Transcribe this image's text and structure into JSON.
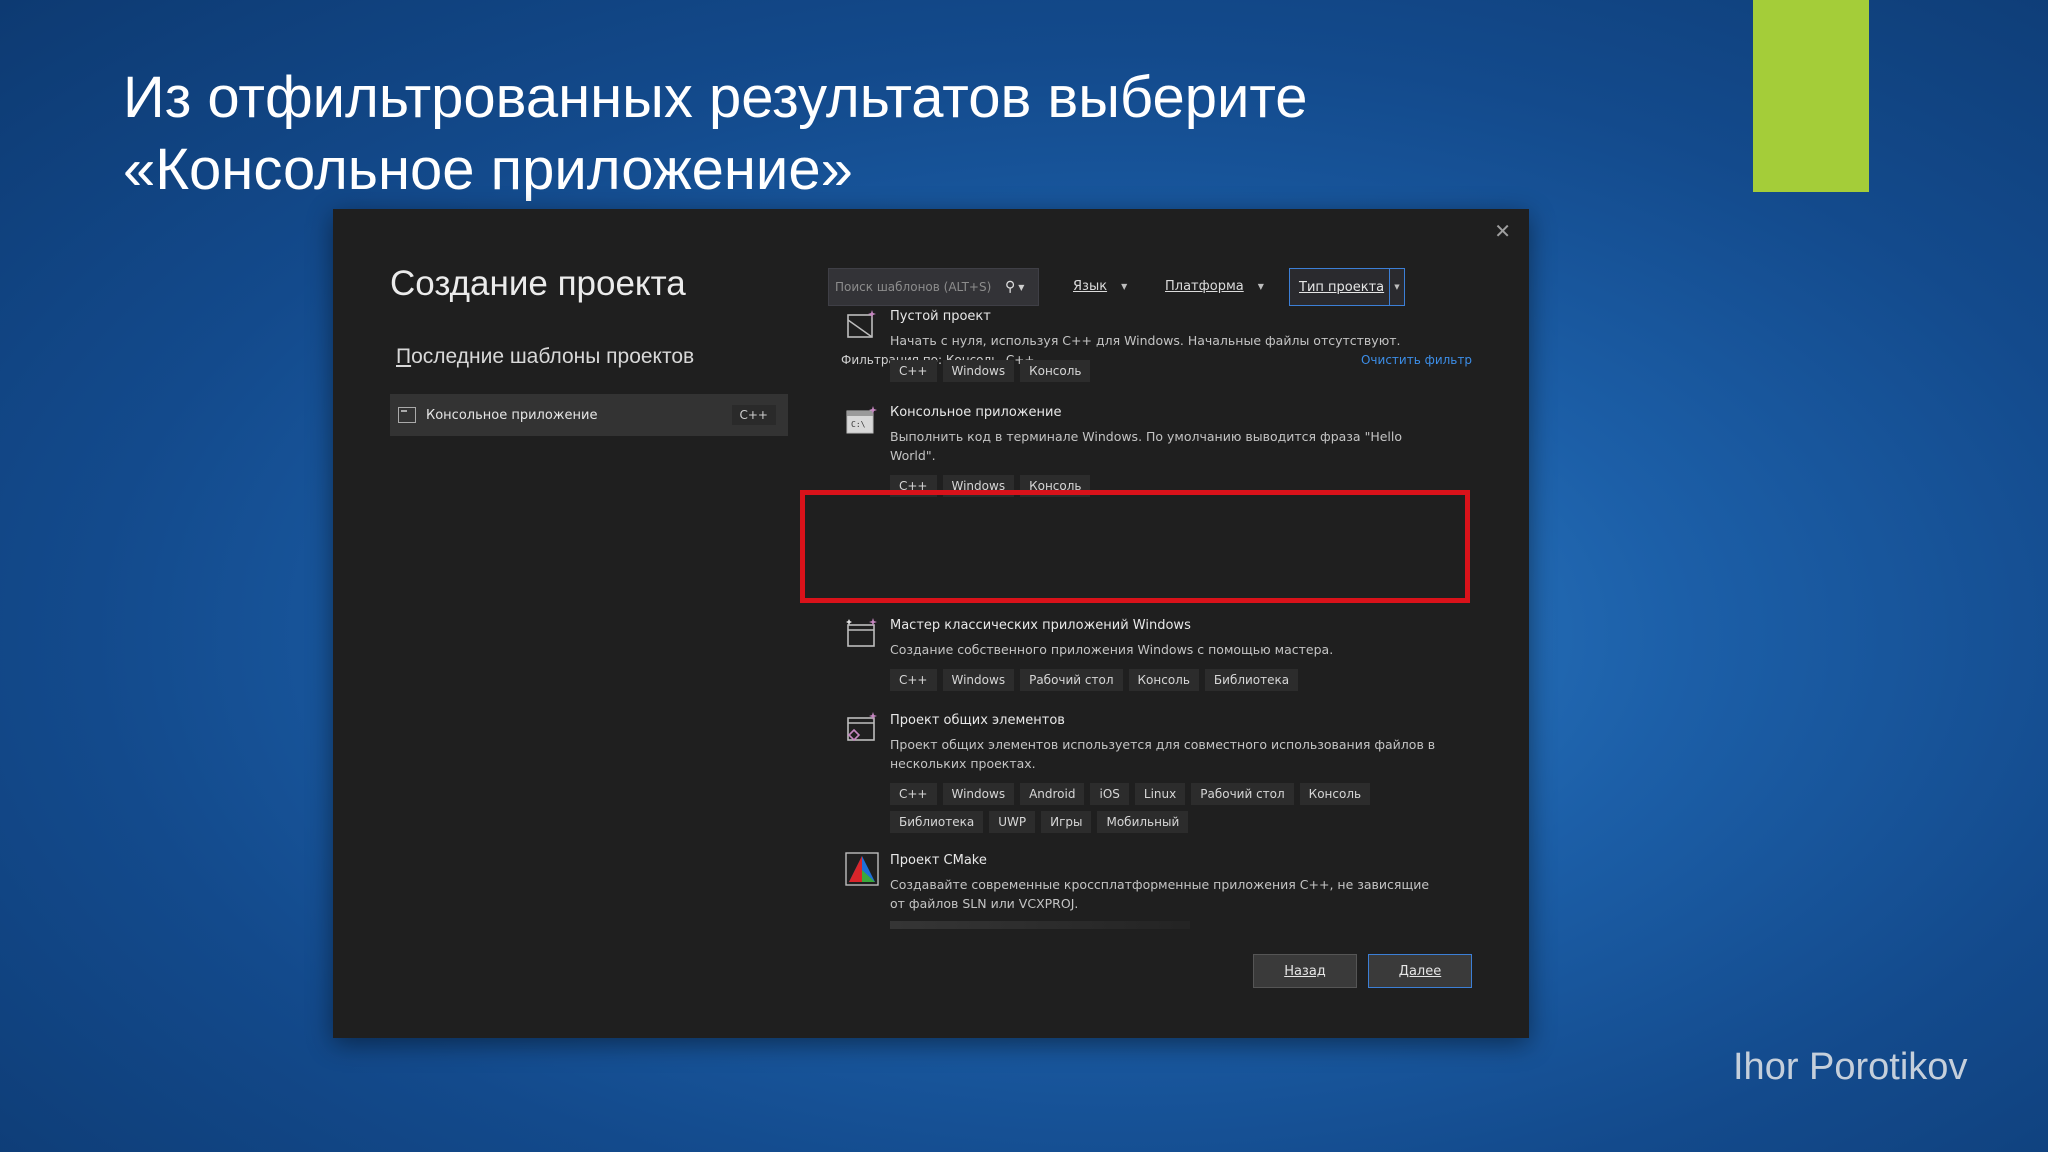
{
  "slide": {
    "title_line1": "Из отфильтрованных результатов выберите",
    "title_line2": "«Консольное приложение»",
    "author": "Ihor Porotikov",
    "accent_color": "#a4cd39"
  },
  "dialog": {
    "title": "Создание проекта",
    "close_icon": "close-icon",
    "recent_title": "Последние шаблоны проектов",
    "recent_items": [
      {
        "label": "Консольное приложение",
        "tag": "C++"
      }
    ],
    "search": {
      "placeholder": "Поиск шаблонов (ALT+S)",
      "value": ""
    },
    "filters": {
      "language": "Язык",
      "platform": "Платформа",
      "project_type": "Тип проекта"
    },
    "filter_status": "Фильтрация по: Консоль, C++",
    "clear_filter": "Очистить фильтр",
    "templates": [
      {
        "name": "Пустой проект",
        "description": "Начать с нуля, используя C++ для Windows. Начальные файлы отсутствуют.",
        "tags": [
          "C++",
          "Windows",
          "Консоль"
        ],
        "icon": "empty-project-icon"
      },
      {
        "name": "Консольное приложение",
        "description": "Выполнить код в терминале Windows. По умолчанию выводится фраза \"Hello World\".",
        "tags": [
          "C++",
          "Windows",
          "Консоль"
        ],
        "icon": "console-app-icon",
        "highlighted": true
      },
      {
        "name": "Мастер классических приложений Windows",
        "description": "Создание собственного приложения Windows с помощью мастера.",
        "tags": [
          "C++",
          "Windows",
          "Рабочий стол",
          "Консоль",
          "Библиотека"
        ],
        "icon": "desktop-wizard-icon"
      },
      {
        "name": "Проект общих элементов",
        "description": "Проект общих элементов используется для совместного использования файлов в нескольких проектах.",
        "tags": [
          "C++",
          "Windows",
          "Android",
          "iOS",
          "Linux",
          "Рабочий стол",
          "Консоль",
          "Библиотека",
          "UWP",
          "Игры",
          "Мобильный"
        ],
        "icon": "shared-items-icon"
      },
      {
        "name": "Проект CMake",
        "description": "Создавайте современные кроссплатформенные приложения C++, не зависящие от файлов SLN или VCXPROJ.",
        "tags": [],
        "icon": "cmake-icon"
      }
    ],
    "buttons": {
      "back": "Назад",
      "next": "Далее"
    },
    "highlight_color": "#d9121a"
  }
}
